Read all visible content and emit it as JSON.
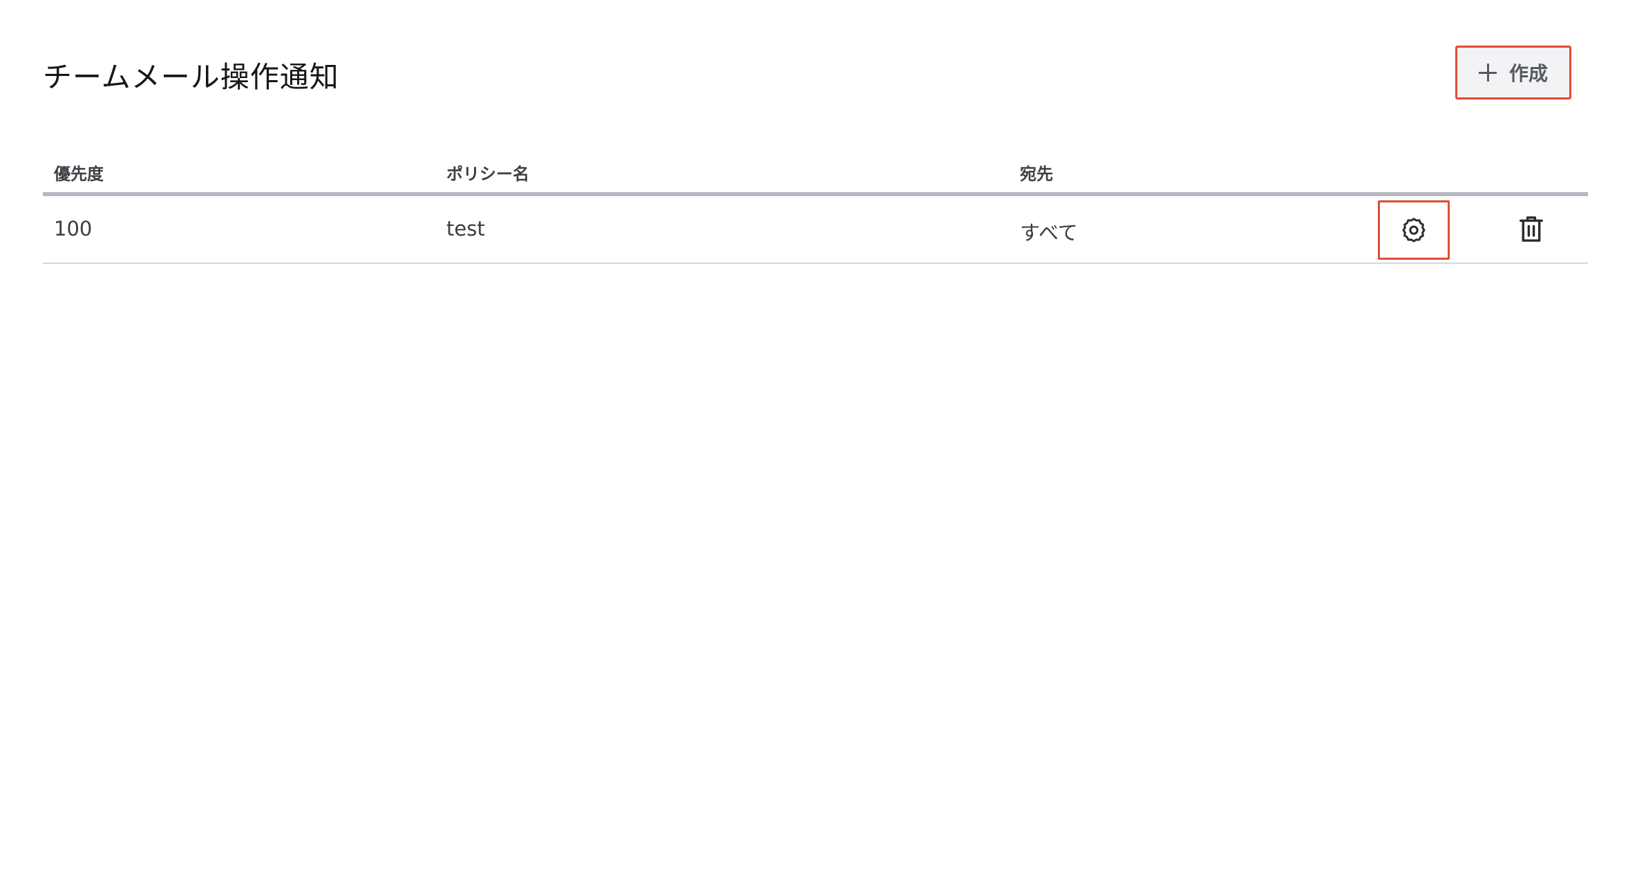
{
  "header": {
    "title": "チームメール操作通知",
    "create_button_label": "作成",
    "create_icon": "plus-icon"
  },
  "table": {
    "columns": {
      "priority": "優先度",
      "policy_name": "ポリシー名",
      "destination": "宛先"
    },
    "rows": [
      {
        "priority": "100",
        "policy_name": "test",
        "destination": "すべて",
        "settings_icon": "gear-icon",
        "delete_icon": "trash-icon"
      }
    ]
  },
  "colors": {
    "highlight_border": "#e04b36",
    "header_rule": "#b7b9c0",
    "button_bg": "#f3f3f5",
    "icon_color": "#2a2c31"
  }
}
